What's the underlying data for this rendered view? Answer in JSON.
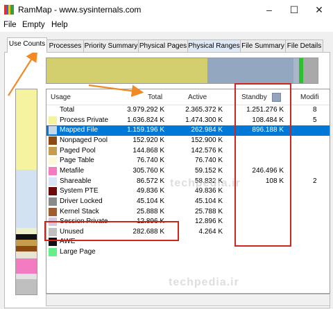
{
  "titlebar": {
    "title": "RamMap - www.sysinternals.com"
  },
  "menubar": {
    "items": [
      "File",
      "Empty",
      "Help"
    ]
  },
  "tabs": [
    "Use Counts",
    "Processes",
    "Priority Summary",
    "Physical Pages",
    "Physical Ranges",
    "File Summary",
    "File Details"
  ],
  "columns": {
    "usage": "Usage",
    "total": "Total",
    "active": "Active",
    "standby": "Standby",
    "modified": "Modifi"
  },
  "rows": [
    {
      "name": "Total",
      "total": "3.979.292 K",
      "active": "2.365.372 K",
      "standby": "1.251.276 K",
      "mod": "8",
      "color": "#ffffff"
    },
    {
      "name": "Process Private",
      "total": "1.636.824 K",
      "active": "1.474.300 K",
      "standby": "108.484 K",
      "mod": "5",
      "color": "#f5f2a0"
    },
    {
      "name": "Mapped File",
      "total": "1.159.196 K",
      "active": "262.984 K",
      "standby": "896.188 K",
      "mod": "",
      "color": "#c7d7ea"
    },
    {
      "name": "Nonpaged Pool",
      "total": "152.920 K",
      "active": "152.900 K",
      "standby": "",
      "mod": "",
      "color": "#8b4a12"
    },
    {
      "name": "Paged Pool",
      "total": "144.868 K",
      "active": "142.576 K",
      "standby": "",
      "mod": "",
      "color": "#c69c4e"
    },
    {
      "name": "Page Table",
      "total": "76.740 K",
      "active": "76.740 K",
      "standby": "",
      "mod": "",
      "color": "#fbf9d8"
    },
    {
      "name": "Metafile",
      "total": "305.760 K",
      "active": "59.152 K",
      "standby": "246.496 K",
      "mod": "",
      "color": "#f27bc2"
    },
    {
      "name": "Shareable",
      "total": "86.572 K",
      "active": "58.832 K",
      "standby": "108 K",
      "mod": "2",
      "color": "#d6e6f6"
    },
    {
      "name": "System PTE",
      "total": "49.836 K",
      "active": "49.836 K",
      "standby": "",
      "mod": "",
      "color": "#6e0a0a"
    },
    {
      "name": "Driver Locked",
      "total": "45.104 K",
      "active": "45.104 K",
      "standby": "",
      "mod": "",
      "color": "#8a8a8a"
    },
    {
      "name": "Kernel Stack",
      "total": "25.888 K",
      "active": "25.788 K",
      "standby": "",
      "mod": "",
      "color": "#a05c2c"
    },
    {
      "name": "Session Private",
      "total": "12.896 K",
      "active": "12.896 K",
      "standby": "",
      "mod": "",
      "color": "#d7c7dc"
    },
    {
      "name": "Unused",
      "total": "282.688 K",
      "active": "4.264 K",
      "standby": "",
      "mod": "",
      "color": "#bfbfbf"
    },
    {
      "name": "AWE",
      "total": "",
      "active": "",
      "standby": "",
      "mod": "",
      "color": "#111111"
    },
    {
      "name": "Large Page",
      "total": "",
      "active": "",
      "standby": "",
      "mod": "",
      "color": "#66ee88"
    }
  ],
  "watermark": "techpedia.ir",
  "colors": {
    "selection": "#0078d7",
    "annotation_red": "#d0231b",
    "annotation_orange": "#f08a24"
  }
}
